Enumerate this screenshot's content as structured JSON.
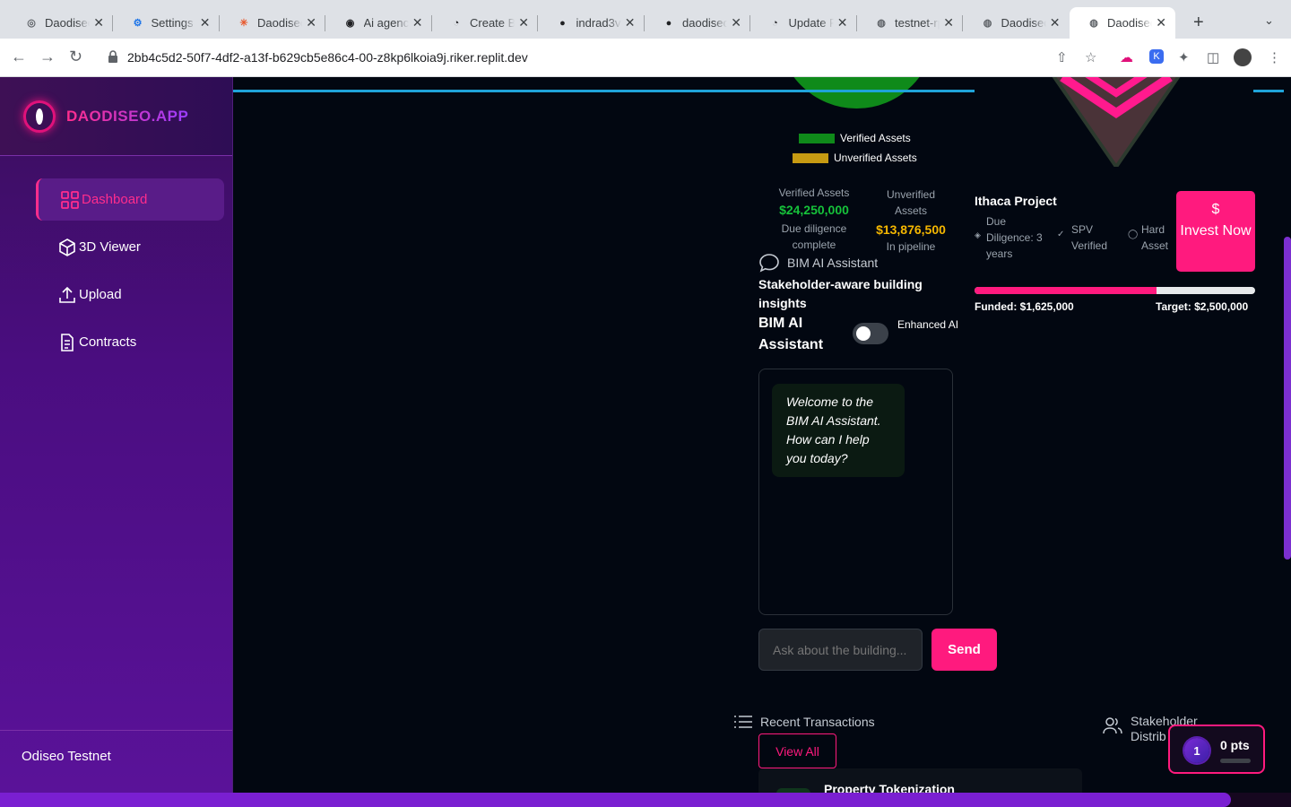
{
  "browser": {
    "tabs": [
      {
        "title": "Daodiseo"
      },
      {
        "title": "Settings -"
      },
      {
        "title": "Daodiseo"
      },
      {
        "title": "Ai agency"
      },
      {
        "title": "Create Bu"
      },
      {
        "title": "indrad3v"
      },
      {
        "title": "daodiseo"
      },
      {
        "title": "Update P"
      },
      {
        "title": "testnet-rp"
      },
      {
        "title": "Daodiseo"
      },
      {
        "title": "Daodiseo"
      }
    ],
    "url": "2bb4c5d2-50f7-4df2-a13f-b629cb5e86c4-00-z8kp6lkoia9j.riker.replit.dev"
  },
  "sidebar": {
    "brand": "DAODISEO.APP",
    "items": [
      {
        "label": "Dashboard"
      },
      {
        "label": "3D Viewer"
      },
      {
        "label": "Upload"
      },
      {
        "label": "Contracts"
      }
    ],
    "network": "Odiseo Testnet"
  },
  "assets": {
    "legend_verified": "Verified Assets",
    "legend_unverified": "Unverified Assets",
    "verified_colour": "#0f8a1a",
    "unverified_colour": "#c79a12",
    "verified_label": "Verified Assets",
    "verified_value": "$24,250,000",
    "verified_note": "Due diligence complete",
    "unverified_label": "Unverified Assets",
    "unverified_value": "$13,876,500",
    "unverified_note": "In pipeline"
  },
  "assistant": {
    "label": "BIM AI Assistant",
    "subtitle": "Stakeholder-aware building insights",
    "heading": "BIM AI Assistant",
    "toggle_label": "Enhanced AI",
    "welcome": "Welcome to the BIM AI Assistant. How can I help you today?",
    "input_placeholder": "Ask about the building...",
    "send": "Send"
  },
  "project": {
    "name": "Ithaca Project",
    "tag_due": "Due Diligence: 3 years",
    "tag_spv": "SPV Verified",
    "tag_hard": "Hard Asset",
    "invest_icon": "$",
    "invest": "Invest Now",
    "funded": "Funded: $1,625,000",
    "target": "Target: $2,500,000",
    "funded_fraction": 0.65
  },
  "transactions": {
    "title": "Recent Transactions",
    "view_all": "View All",
    "first_item": "Property Tokenization"
  },
  "stakeholder": {
    "title": "Stakeholder Distrib"
  },
  "points": {
    "level": "1",
    "label": "0 pts"
  }
}
